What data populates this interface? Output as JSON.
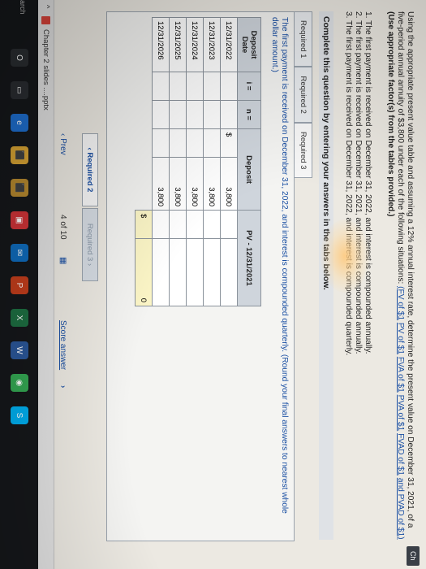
{
  "corner_tab": "Ch",
  "intro": {
    "text": "Using the appropriate present value table and assuming a 12% annual interest rate, determine the present value on December 31, 2021, of a five-period annual annuity of $3,800 under each of the following situations:",
    "links": [
      "(FV of $1",
      "PV of $1",
      "FVA of $1",
      "PVA of $1",
      "FVAD of $1",
      "and PVAD of $1)"
    ],
    "bold": "(Use appropriate factor(s) from the tables provided.)"
  },
  "situations": [
    "1. The first payment is received on December 31, 2022, and interest is compounded annually.",
    "2. The first payment is received on December 31, 2021, and interest is compounded annually.",
    "3. The first payment is received on December 31, 2022, and interest is compounded quarterly."
  ],
  "complete_heading": "Complete this question by entering your answers in the tabs below.",
  "tabs": [
    "Required 1",
    "Required 2",
    "Required 3"
  ],
  "instruction": "The first payment is received on December 31, 2022, and interest is compounded quarterly. (Round your final answers to nearest whole dollar amount.)",
  "table": {
    "headers": [
      "Deposit Date",
      "i =",
      "n =",
      "Deposit",
      "PV - 12/31/2021"
    ],
    "rows": [
      {
        "date": "12/31/2022",
        "dollar": "$",
        "deposit": "3,800"
      },
      {
        "date": "12/31/2023",
        "dollar": "",
        "deposit": "3,800"
      },
      {
        "date": "12/31/2024",
        "dollar": "",
        "deposit": "3,800"
      },
      {
        "date": "12/31/2025",
        "dollar": "",
        "deposit": "3,800"
      },
      {
        "date": "12/31/2026",
        "dollar": "",
        "deposit": "3,800"
      }
    ],
    "total_dollar": "$",
    "total_value": "0"
  },
  "nav": {
    "prev_button": "‹  Required 2",
    "next_button": "Required 3  ›"
  },
  "pager": {
    "prev": "‹  Prev",
    "count": "4 of 10",
    "grid_icon": "▦",
    "score": "Score answer",
    "next_arrow": "›"
  },
  "download": {
    "chevron": "^",
    "filename": "Chapter 2 slides ....pptx",
    "chevron2": "^"
  },
  "taskbar": {
    "search": "arch",
    "icons": [
      "O",
      "▭",
      "e",
      "⬛",
      "⬛",
      "▣",
      "✉",
      "P",
      "X",
      "W",
      "◉",
      "S"
    ]
  },
  "colors": {
    "link": "#1a4fa3",
    "header_bg": "#cfd5dc",
    "total_bg": "#fbf5c6",
    "taskbar_bg": "#15171a"
  }
}
